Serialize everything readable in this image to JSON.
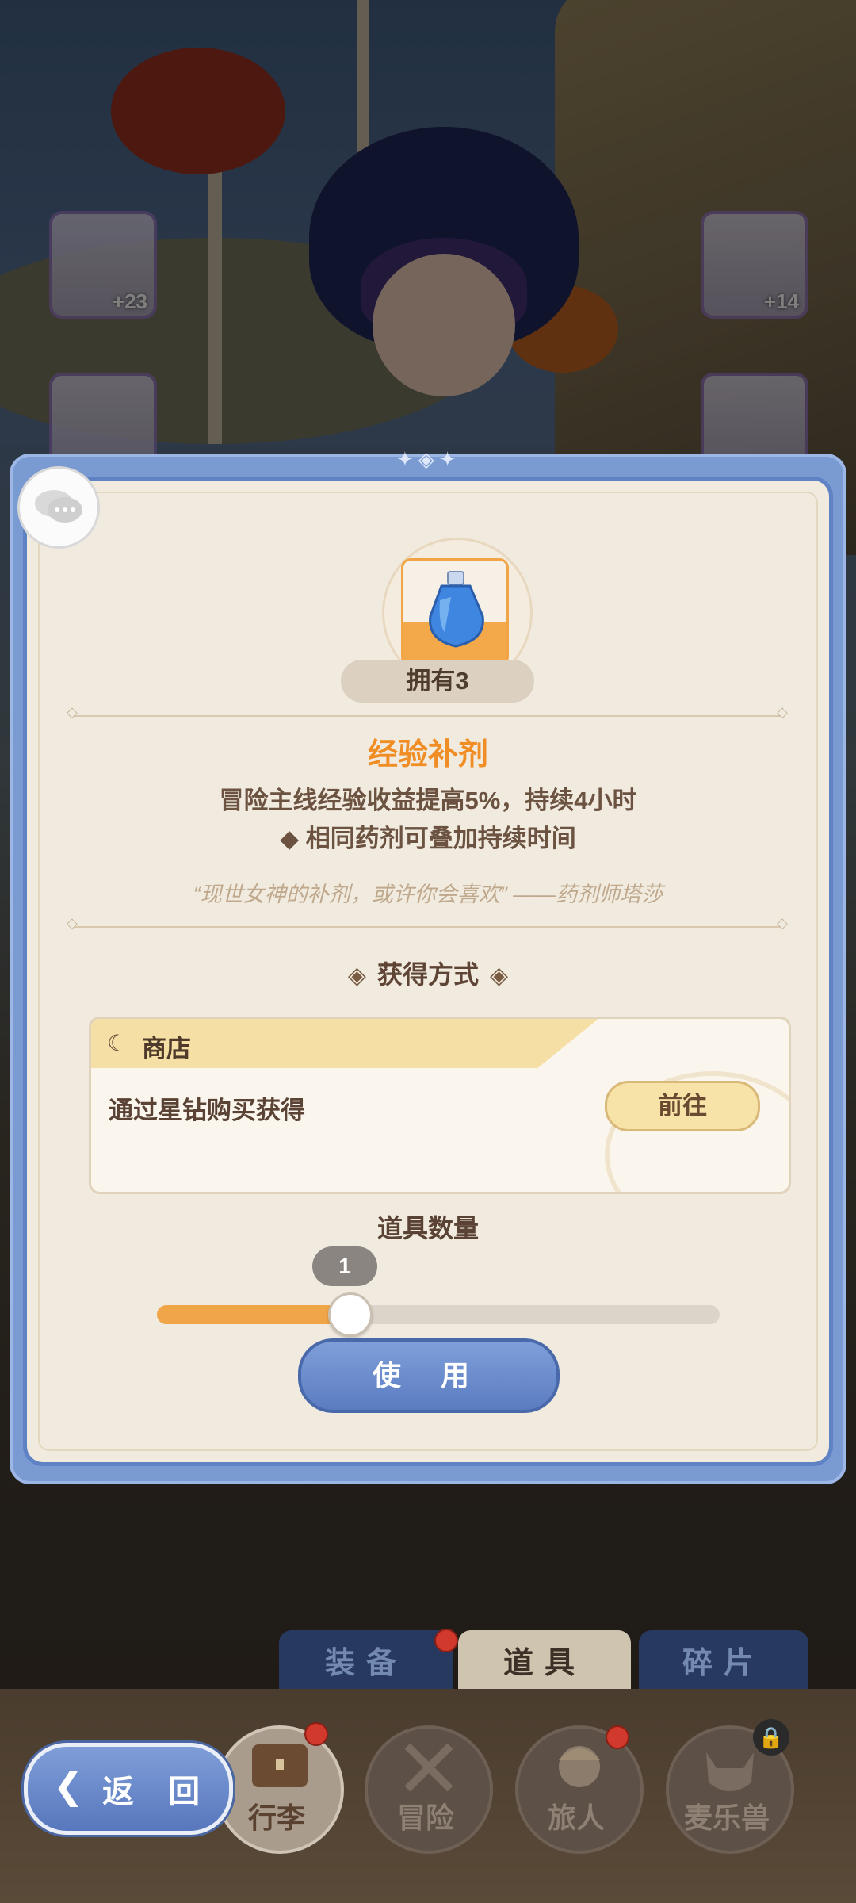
{
  "item": {
    "owned_label": "拥有3",
    "name": "经验补剂",
    "description_line1": "冒险主线经验收益提高5%，持续4小时",
    "description_line2": "◆ 相同药剂可叠加持续时间",
    "quote": "“现世女神的补剂，或许你会喜欢” ——药剂师塔莎"
  },
  "obtain": {
    "title": "获得方式",
    "source_label": "商店",
    "source_description": "通过星钻购买获得",
    "go_button": "前往"
  },
  "quantity": {
    "title": "道具数量",
    "value": "1",
    "slider_fraction": 0.34
  },
  "use_button": "使 用",
  "inventory_side_slots": [
    {
      "count": "+23"
    },
    {
      "count": "+14"
    }
  ],
  "tabs": [
    {
      "label": "装备",
      "badge": true,
      "selected": false
    },
    {
      "label": "道具",
      "badge": false,
      "selected": true
    },
    {
      "label": "碎片",
      "badge": false,
      "selected": false
    }
  ],
  "bottom_nav": [
    {
      "label": "行李",
      "badge": true,
      "active": true
    },
    {
      "label": "冒险",
      "badge": false,
      "active": false
    },
    {
      "label": "旅人",
      "badge": true,
      "active": false
    },
    {
      "label": "麦乐兽",
      "badge": false,
      "active": false,
      "locked": true
    }
  ],
  "back_button": "返 回",
  "colors": {
    "accent_orange": "#f08d25",
    "dialog_blue": "#7a9ad2",
    "badge_red": "#d0392b"
  }
}
